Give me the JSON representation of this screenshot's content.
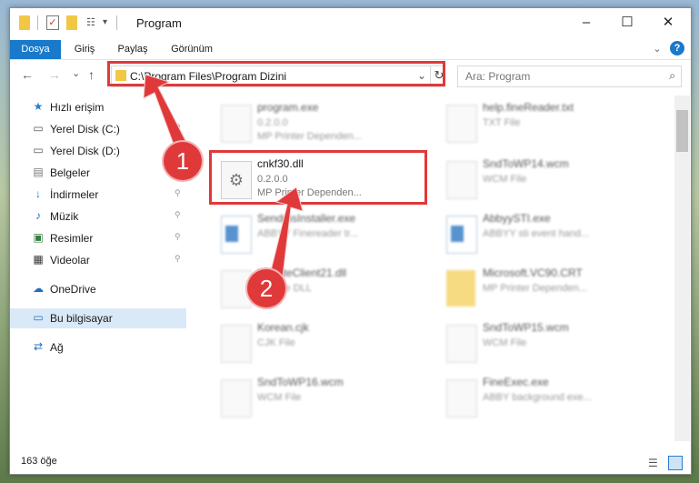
{
  "window": {
    "title": "Program",
    "minimize": "–",
    "maximize": "☐",
    "close": "✕"
  },
  "ribbon": {
    "tabs": [
      "Dosya",
      "Giriş",
      "Paylaş",
      "Görünüm"
    ],
    "expand": "⌄",
    "help": "?"
  },
  "address": {
    "path": "C:\\Program Files\\Program Dizini",
    "dropdown": "⌄",
    "refresh": "↻"
  },
  "search": {
    "placeholder": "Ara: Program"
  },
  "nav_arrows": {
    "back": "←",
    "forward": "→",
    "recent": "⌄",
    "up": "↑"
  },
  "sidebar": {
    "items": [
      {
        "label": "Hızlı erişim"
      },
      {
        "label": "Yerel Disk (C:)"
      },
      {
        "label": "Yerel Disk (D:)"
      },
      {
        "label": "Belgeler"
      },
      {
        "label": "İndirmeler"
      },
      {
        "label": "Müzik"
      },
      {
        "label": "Resimler"
      },
      {
        "label": "Videolar"
      },
      {
        "label": "OneDrive"
      },
      {
        "label": "Bu bilgisayar"
      },
      {
        "label": "Ağ"
      }
    ]
  },
  "files": [
    {
      "name": "program.exe",
      "line1": "0.2.0.0",
      "line2": "MP Printer Dependen..."
    },
    {
      "name": "help.fineReader.txt",
      "line1": "TXT File",
      "line2": ""
    },
    {
      "name": "cnkf30.dll",
      "line1": "0.2.0.0",
      "line2": "MP Printer Dependen..."
    },
    {
      "name": "SndToWP14.wcm",
      "line1": "WCM File",
      "line2": ""
    },
    {
      "name": "SendmsInstaller.exe",
      "line1": "ABBYY Finereader tr...",
      "line2": ""
    },
    {
      "name": "AbbyySTI.exe",
      "line1": "ABBYY sti event hand...",
      "line2": ""
    },
    {
      "name": "UpdateClient21.dll",
      "line1": "Service DLL",
      "line2": ""
    },
    {
      "name": "Microsoft.VC90.CRT",
      "line1": "MP Printer Dependen...",
      "line2": ""
    },
    {
      "name": "Korean.cjk",
      "line1": "CJK File",
      "line2": ""
    },
    {
      "name": "SndToWP15.wcm",
      "line1": "WCM File",
      "line2": ""
    },
    {
      "name": "SndToWP16.wcm",
      "line1": "WCM File",
      "line2": ""
    },
    {
      "name": "FineExec.exe",
      "line1": "ABBY background exe...",
      "line2": ""
    }
  ],
  "status": {
    "count": "163 öğe"
  },
  "annotations": {
    "badge1": "1",
    "badge2": "2",
    "color": "#e0393a"
  }
}
